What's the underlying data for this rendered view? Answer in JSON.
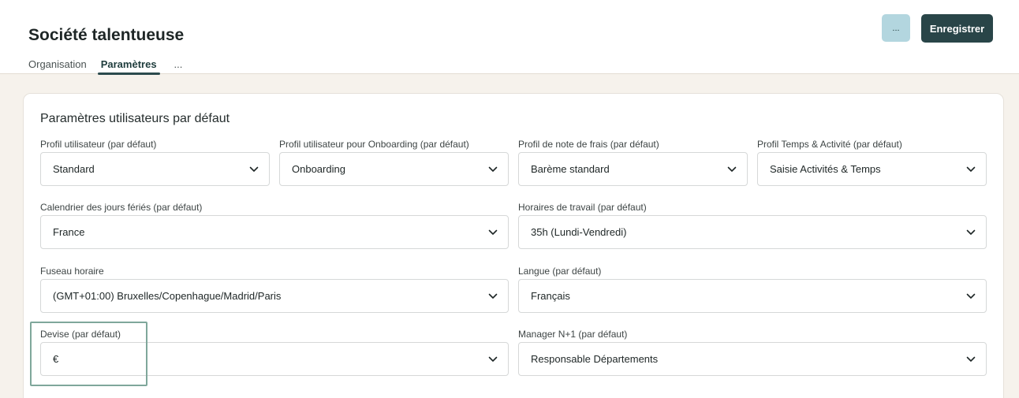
{
  "header": {
    "title": "Société talentueuse",
    "tabs": [
      {
        "label": "Organisation",
        "active": false
      },
      {
        "label": "Paramètres",
        "active": true
      },
      {
        "label": "...",
        "active": false
      }
    ],
    "more_button_label": "...",
    "save_button_label": "Enregistrer"
  },
  "card": {
    "title": "Paramètres utilisateurs par défaut",
    "fields": {
      "user_profile": {
        "label": "Profil utilisateur (par défaut)",
        "value": "Standard"
      },
      "onboarding_profile": {
        "label": "Profil utilisateur pour Onboarding (par défaut)",
        "value": "Onboarding"
      },
      "expense_profile": {
        "label": "Profil de note de frais (par défaut)",
        "value": "Barème standard"
      },
      "time_profile": {
        "label": "Profil Temps & Activité (par défaut)",
        "value": "Saisie Activités & Temps"
      },
      "holiday_calendar": {
        "label": "Calendrier des jours fériés (par défaut)",
        "value": "France"
      },
      "working_hours": {
        "label": "Horaires de travail (par défaut)",
        "value": "35h (Lundi-Vendredi)"
      },
      "timezone": {
        "label": "Fuseau horaire",
        "value": "(GMT+01:00) Bruxelles/Copenhague/Madrid/Paris"
      },
      "language": {
        "label": "Langue (par défaut)",
        "value": "Français"
      },
      "currency": {
        "label": "Devise (par défaut)",
        "value": "€"
      },
      "manager": {
        "label": "Manager N+1 (par défaut)",
        "value": "Responsable Départements"
      }
    }
  },
  "colors": {
    "primary": "#294548",
    "secondary_button": "#b3d6df",
    "background": "#f6f2ec",
    "highlight": "#7fa79b"
  }
}
